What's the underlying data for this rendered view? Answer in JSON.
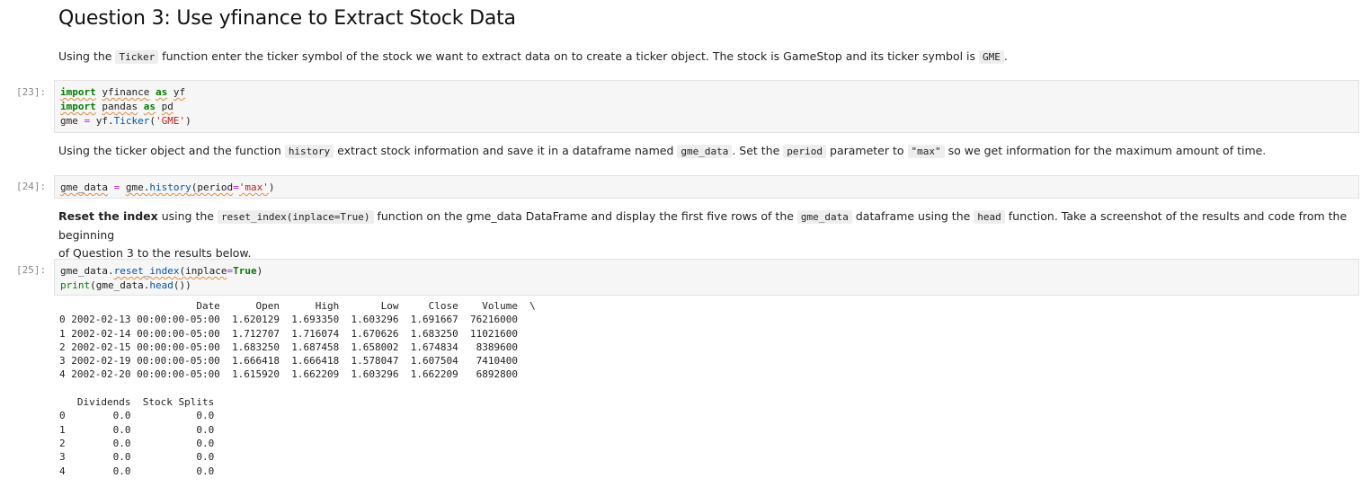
{
  "heading": "Question 3: Use yfinance to Extract Stock Data",
  "para1": {
    "t1": "Using the ",
    "c1": "Ticker",
    "t2": " function enter the ticker symbol of the stock we want to extract data on to create a ticker object. The stock is GameStop and its ticker symbol is ",
    "c2": "GME",
    "t3": "."
  },
  "cell23": {
    "prompt": "[23]:",
    "l1": {
      "kw1": "import",
      "mod": "yfinance",
      "kw2": "as",
      "alias": "yf"
    },
    "l2": {
      "kw1": "import",
      "mod": "pandas",
      "kw2": "as",
      "alias": "pd"
    },
    "l3": {
      "var": "gme",
      "eq": "=",
      "obj": "yf.",
      "fn": "Ticker",
      "open": "(",
      "str": "'GME'",
      "close": ")"
    }
  },
  "para2": {
    "t1": "Using the ticker object and the function ",
    "c1": "history",
    "t2": " extract stock information and save it in a dataframe named ",
    "c2": "gme_data",
    "t3": ". Set the ",
    "c3": "period",
    "t4": " parameter to ",
    "c4": "\"max\"",
    "t5": " so we get information for the maximum amount of time."
  },
  "cell24": {
    "prompt": "[24]:",
    "var": "gme_data",
    "eq": "=",
    "obj": "gme.",
    "fn": "history",
    "arg": "(period",
    "eq2": "=",
    "str": "'max'",
    "close": ")"
  },
  "para3": {
    "bold": "Reset the index",
    "t1": " using the ",
    "c1": "reset_index(inplace=True)",
    "t2": " function on the gme_data DataFrame and display the first five rows of the ",
    "c2": "gme_data",
    "t3": " dataframe using the ",
    "c3": "head",
    "t4": " function. Take a screenshot of the results and code from the beginning",
    "line2": "of Question 3 to the results below."
  },
  "cell25": {
    "prompt": "[25]:",
    "l1": {
      "obj": "gme_data.",
      "fn": "reset_index",
      "arg": "(inplace",
      "eq": "=",
      "val": "True",
      "close": ")"
    },
    "l2": {
      "fn": "print",
      "open": "(gme_data.",
      "fn2": "head",
      "close": "())"
    }
  },
  "output": {
    "table1": {
      "header": "                       Date      Open      High       Low     Close    Volume  \\",
      "rows": [
        "0 2002-02-13 00:00:00-05:00  1.620129  1.693350  1.603296  1.691667  76216000",
        "1 2002-02-14 00:00:00-05:00  1.712707  1.716074  1.670626  1.683250  11021600",
        "2 2002-02-15 00:00:00-05:00  1.683250  1.687458  1.658002  1.674834   8389600",
        "3 2002-02-19 00:00:00-05:00  1.666418  1.666418  1.578047  1.607504   7410400",
        "4 2002-02-20 00:00:00-05:00  1.615920  1.662209  1.603296  1.662209   6892800"
      ]
    },
    "table2": {
      "header": "   Dividends  Stock Splits",
      "rows": [
        "0        0.0           0.0",
        "1        0.0           0.0",
        "2        0.0           0.0",
        "3        0.0           0.0",
        "4        0.0           0.0"
      ]
    }
  }
}
